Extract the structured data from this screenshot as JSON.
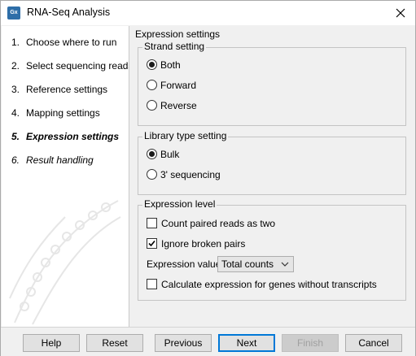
{
  "window": {
    "title": "RNA-Seq Analysis",
    "icon": "clc-workbench-icon"
  },
  "steps": [
    {
      "num": "1.",
      "label": "Choose where to run",
      "state": "done"
    },
    {
      "num": "2.",
      "label": "Select sequencing reads",
      "state": "done"
    },
    {
      "num": "3.",
      "label": "Reference settings",
      "state": "done"
    },
    {
      "num": "4.",
      "label": "Mapping settings",
      "state": "done"
    },
    {
      "num": "5.",
      "label": "Expression settings",
      "state": "current"
    },
    {
      "num": "6.",
      "label": "Result handling",
      "state": "future"
    }
  ],
  "content": {
    "heading": "Expression settings",
    "strand": {
      "legend": "Strand setting",
      "options": [
        {
          "label": "Both",
          "selected": true
        },
        {
          "label": "Forward",
          "selected": false
        },
        {
          "label": "Reverse",
          "selected": false
        }
      ]
    },
    "library": {
      "legend": "Library type setting",
      "options": [
        {
          "label": "Bulk",
          "selected": true
        },
        {
          "label": "3' sequencing",
          "selected": false
        }
      ]
    },
    "expression": {
      "legend": "Expression level",
      "count_paired": {
        "label": "Count paired reads as two",
        "checked": false
      },
      "ignore_broken": {
        "label": "Ignore broken pairs",
        "checked": true
      },
      "value_label": "Expression value",
      "value_selected": "Total counts",
      "calc_without_transcripts": {
        "label": "Calculate expression for genes without transcripts",
        "checked": false
      }
    }
  },
  "buttons": {
    "help": "Help",
    "reset": "Reset",
    "previous": "Previous",
    "next": "Next",
    "finish": "Finish",
    "cancel": "Cancel"
  },
  "colors": {
    "accent": "#0078d7",
    "panel": "#f0f0f0",
    "sidebar": "#ffffff"
  }
}
